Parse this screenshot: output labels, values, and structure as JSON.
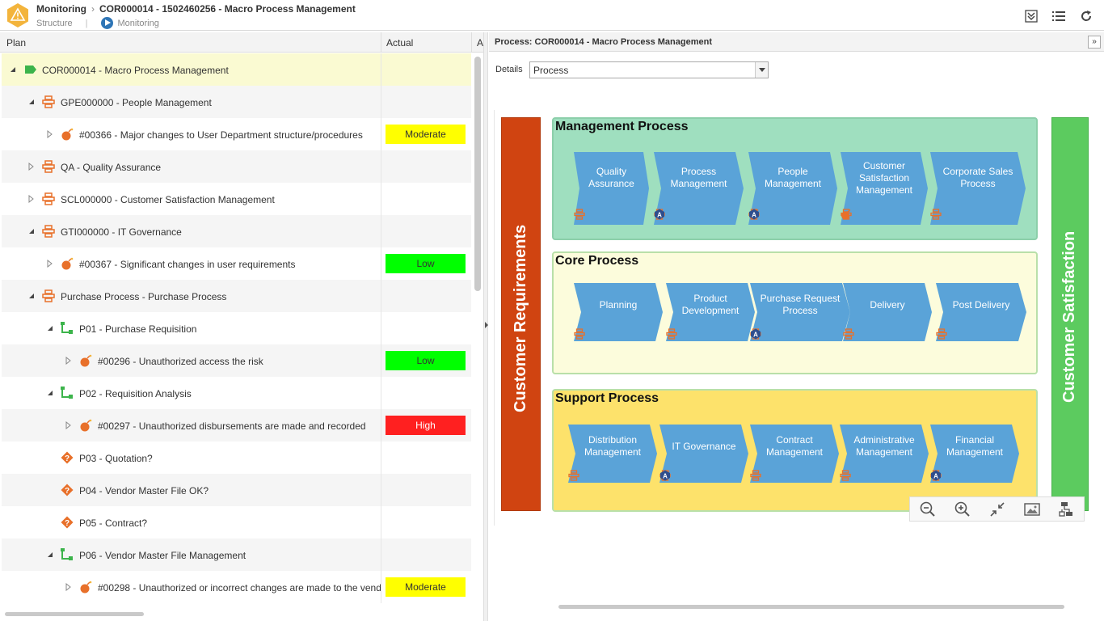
{
  "header": {
    "module": "Monitoring",
    "breadcrumb": "COR000014 - 1502460256 - Macro Process Management",
    "subnav_structure": "Structure",
    "subnav_monitoring": "Monitoring"
  },
  "left_panel": {
    "col_plan": "Plan",
    "col_actual": "Actual",
    "col_a": "A",
    "rows": [
      {
        "label": "COR000014 - Macro Process Management",
        "icon": "process-flag-icon",
        "actual": ""
      },
      {
        "label": "GPE000000 - People Management",
        "icon": "process-icon",
        "actual": ""
      },
      {
        "label": "#00366 - Major changes to User Department structure/procedures",
        "icon": "risk-bomb-icon",
        "actual": "Moderate"
      },
      {
        "label": "QA - Quality Assurance",
        "icon": "process-icon",
        "actual": ""
      },
      {
        "label": "SCL000000 - Customer Satisfaction Management",
        "icon": "process-icon",
        "actual": ""
      },
      {
        "label": "GTI000000 - IT Governance",
        "icon": "process-icon",
        "actual": ""
      },
      {
        "label": "#00367 - Significant changes in user requirements",
        "icon": "risk-bomb-icon",
        "actual": "Low"
      },
      {
        "label": "Purchase Process - Purchase Process",
        "icon": "process-icon",
        "actual": ""
      },
      {
        "label": "P01 - Purchase Requisition",
        "icon": "activity-icon",
        "actual": ""
      },
      {
        "label": "#00296 - Unauthorized access the risk",
        "icon": "risk-bomb-icon",
        "actual": "Low"
      },
      {
        "label": "P02 - Requisition Analysis",
        "icon": "activity-icon",
        "actual": ""
      },
      {
        "label": "#00297 - Unauthorized disbursements are made and recorded",
        "icon": "risk-bomb-icon",
        "actual": "High"
      },
      {
        "label": "P03 - Quotation?",
        "icon": "decision-icon",
        "actual": ""
      },
      {
        "label": "P04 - Vendor Master File OK?",
        "icon": "decision-icon",
        "actual": ""
      },
      {
        "label": "P05 - Contract?",
        "icon": "decision-icon",
        "actual": ""
      },
      {
        "label": "P06 - Vendor Master File Management",
        "icon": "activity-icon",
        "actual": ""
      },
      {
        "label": "#00298 - Unauthorized or incorrect changes are made to the vend",
        "icon": "risk-bomb-icon",
        "actual": "Moderate"
      }
    ],
    "badge_colors": {
      "Moderate": "#ffff00",
      "Low": "#00ff00",
      "High": "#ff2020"
    }
  },
  "right_panel": {
    "title": "Process: COR000014 - Macro Process Management",
    "details_label": "Details",
    "details_value": "Process",
    "left_bar": "Customer Requirements",
    "right_bar": "Customer Satisfaction",
    "lanes": {
      "management": {
        "title": "Management Process",
        "steps": [
          "Quality Assurance",
          "Process Management",
          "People Management",
          "Customer Satisfaction Management",
          "Corporate Sales Process"
        ]
      },
      "core": {
        "title": "Core Process",
        "steps": [
          "Planning",
          "Product Development",
          "Purchase Request Process",
          "Delivery",
          "Post Delivery"
        ]
      },
      "support": {
        "title": "Support Process",
        "steps": [
          "Distribution Management",
          "IT Governance",
          "Contract Management",
          "Administrative Management",
          "Financial Management"
        ]
      }
    },
    "zoom_tools": [
      "zoom-out-icon",
      "zoom-in-icon",
      "fit-icon",
      "image-export-icon",
      "layout-icon"
    ]
  }
}
